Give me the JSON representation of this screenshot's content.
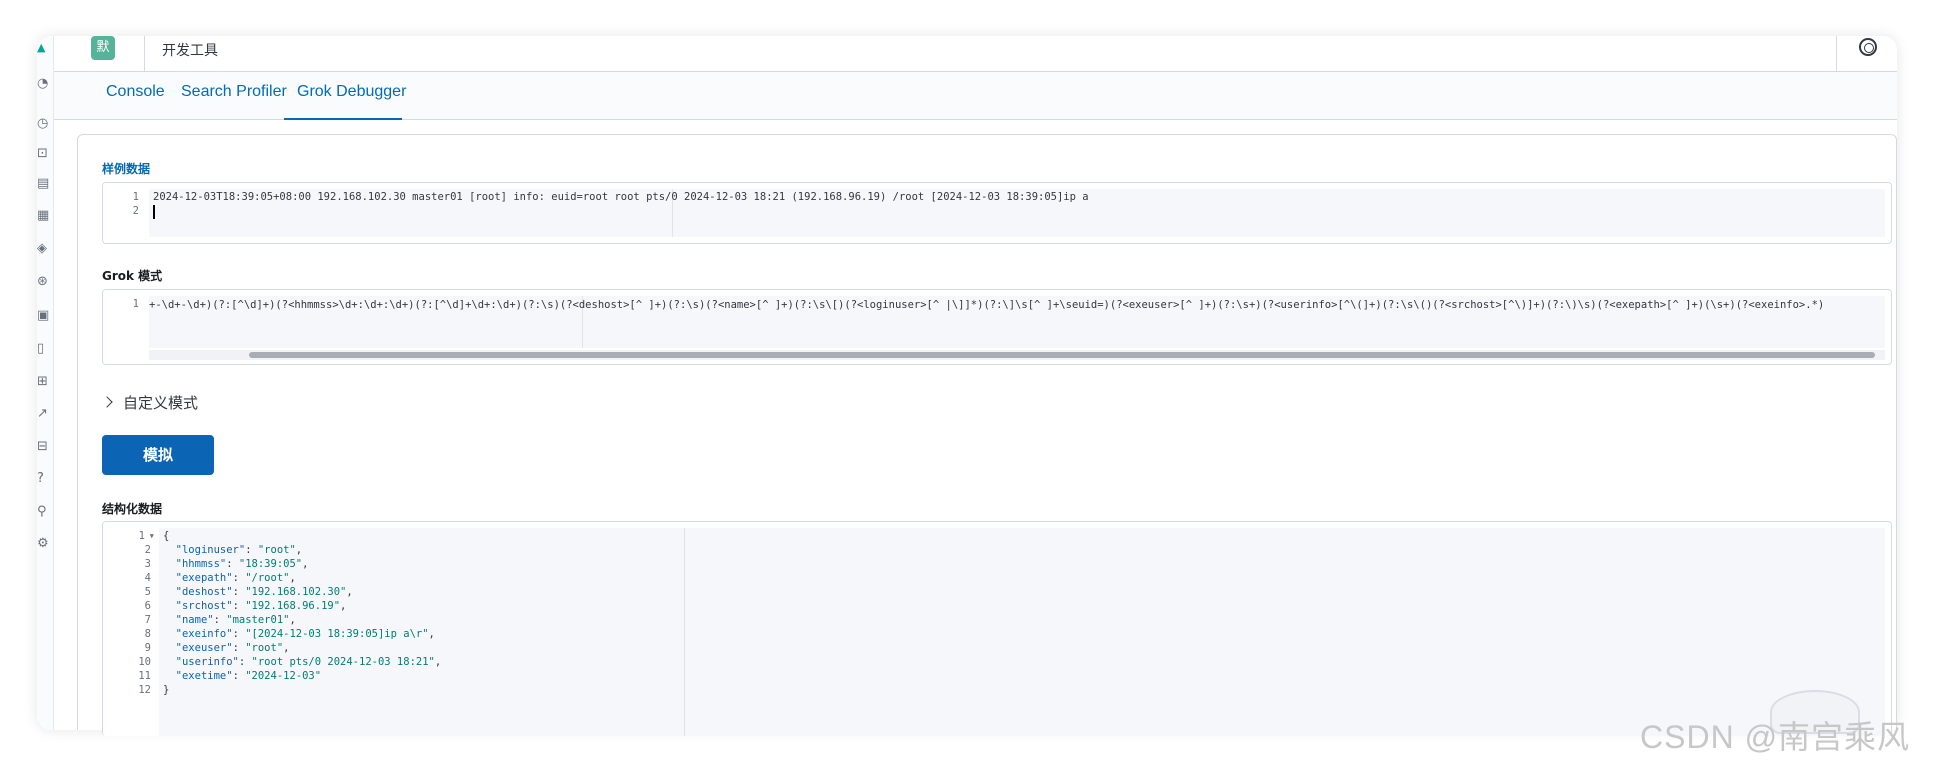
{
  "header": {
    "space_badge": "默",
    "title": "开发工具"
  },
  "tabs": [
    {
      "label": "Console"
    },
    {
      "label": "Search Profiler"
    },
    {
      "label": "Grok Debugger"
    }
  ],
  "sample_data": {
    "label": "样例数据",
    "lines": [
      "2024-12-03T18:39:05+08:00 192.168.102.30 master01 [root] info: euid=root root pts/0 2024-12-03 18:21 (192.168.96.19) /root [2024-12-03 18:39:05]ip a",
      ""
    ]
  },
  "grok_pattern": {
    "label": "Grok 模式",
    "lines": [
      "+-\\d+-\\d+)(?:[^\\d]+)(?<hhmmss>\\d+:\\d+:\\d+)(?:[^\\d]+\\d+:\\d+)(?:\\s)(?<deshost>[^ ]+)(?:\\s)(?<name>[^ ]+)(?:\\s\\[)(?<loginuser>[^ |\\]]*)(?:\\]\\s[^ ]+\\seuid=)(?<exeuser>[^ ]+)(?:\\s+)(?<userinfo>[^\\(]+)(?:\\s\\()(?<srchost>[^\\)]+)(?:\\)\\s)(?<exepath>[^ ]+)(\\s+)(?<exeinfo>.*)"
    ]
  },
  "custom_patterns": {
    "label": "自定义模式"
  },
  "simulate_button": {
    "label": "模拟"
  },
  "structured_data": {
    "label": "结构化数据",
    "lines": [
      {
        "n": "1",
        "fold": "▾",
        "key": "",
        "value": "",
        "raw": "{"
      },
      {
        "n": "2",
        "key": "\"loginuser\"",
        "value": "\"root\"",
        "tail": ","
      },
      {
        "n": "3",
        "key": "\"hhmmss\"",
        "value": "\"18:39:05\"",
        "tail": ","
      },
      {
        "n": "4",
        "key": "\"exepath\"",
        "value": "\"/root\"",
        "tail": ","
      },
      {
        "n": "5",
        "key": "\"deshost\"",
        "value": "\"192.168.102.30\"",
        "tail": ","
      },
      {
        "n": "6",
        "key": "\"srchost\"",
        "value": "\"192.168.96.19\"",
        "tail": ","
      },
      {
        "n": "7",
        "key": "\"name\"",
        "value": "\"master01\"",
        "tail": ","
      },
      {
        "n": "8",
        "key": "\"exeinfo\"",
        "value": "\"[2024-12-03 18:39:05]ip a\\r\"",
        "tail": ","
      },
      {
        "n": "9",
        "key": "\"exeuser\"",
        "value": "\"root\"",
        "tail": ","
      },
      {
        "n": "10",
        "key": "\"userinfo\"",
        "value": "\"root pts/0 2024-12-03 18:21\"",
        "tail": ","
      },
      {
        "n": "11",
        "key": "\"exetime\"",
        "value": "\"2024-12-03\"",
        "tail": ""
      },
      {
        "n": "12",
        "key": "",
        "value": "",
        "raw": "}"
      }
    ]
  },
  "watermark": "CSDN @南宫乘风",
  "colors": {
    "accent": "#006bb8",
    "button": "#0b64b4",
    "json_key": "#0b64b4",
    "json_string": "#017d73",
    "space_badge": "#54b399"
  }
}
